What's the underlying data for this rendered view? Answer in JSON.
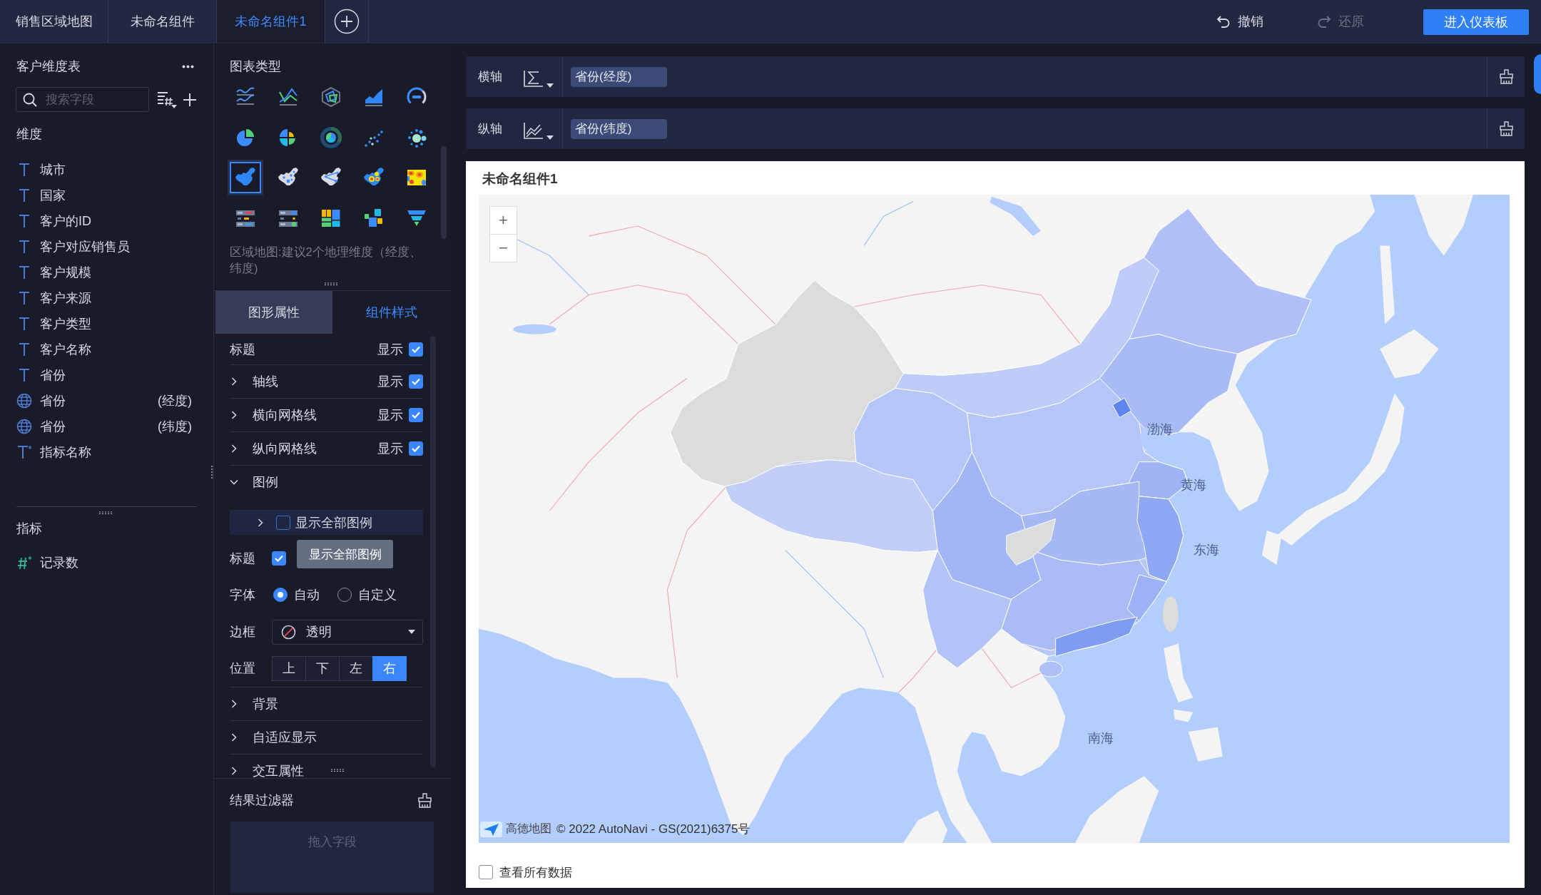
{
  "top_bar": {
    "tabs": [
      {
        "label": "销售区域地图",
        "selected": false
      },
      {
        "label": "未命名组件",
        "selected": false
      },
      {
        "label": "未命名组件1",
        "selected": true
      }
    ],
    "actions": [
      {
        "kind": "undo",
        "label": "撤销",
        "disabled": false
      },
      {
        "kind": "redo",
        "label": "还原",
        "disabled": true
      }
    ],
    "primary_button": "进入仪表板"
  },
  "fields_panel": {
    "title": "客户维度表",
    "search": {
      "placeholder": "搜索字段"
    },
    "dimensions": {
      "title": "维度",
      "items": [
        {
          "kind": "text",
          "label": "城市"
        },
        {
          "kind": "text",
          "label": "国家"
        },
        {
          "kind": "text",
          "label": "客户的ID"
        },
        {
          "kind": "text",
          "label": "客户对应销售员"
        },
        {
          "kind": "text",
          "label": "客户规模"
        },
        {
          "kind": "text",
          "label": "客户来源"
        },
        {
          "kind": "text",
          "label": "客户类型"
        },
        {
          "kind": "text",
          "label": "客户名称"
        },
        {
          "kind": "text",
          "label": "省份"
        },
        {
          "kind": "geo",
          "label": "省份",
          "qualifier": "(经度)"
        },
        {
          "kind": "geo",
          "label": "省份",
          "qualifier": "(纬度)"
        },
        {
          "kind": "text-calculated",
          "label": "指标名称"
        }
      ]
    },
    "measures": {
      "title": "指标",
      "items": [
        {
          "kind": "number-calculated",
          "label": "记录数"
        }
      ]
    }
  },
  "chart_types": {
    "title": "图表类型",
    "items": [
      {
        "kind": "multi-line",
        "selected": false
      },
      {
        "kind": "line",
        "selected": false
      },
      {
        "kind": "radar",
        "selected": false
      },
      {
        "kind": "area",
        "selected": false
      },
      {
        "kind": "gauge",
        "selected": false
      },
      {
        "kind": "pie",
        "selected": false
      },
      {
        "kind": "quadrant-pie",
        "selected": false
      },
      {
        "kind": "nested-donut",
        "selected": false
      },
      {
        "kind": "scatter",
        "selected": false
      },
      {
        "kind": "bubble",
        "selected": false
      },
      {
        "kind": "region-map",
        "selected": true
      },
      {
        "kind": "point-map",
        "selected": false
      },
      {
        "kind": "flow-map",
        "selected": false
      },
      {
        "kind": "heat-map",
        "selected": false
      },
      {
        "kind": "heatmap-grid",
        "selected": false
      },
      {
        "kind": "kpi-table",
        "selected": false
      },
      {
        "kind": "indicator-list",
        "selected": false
      },
      {
        "kind": "treemap",
        "selected": false
      },
      {
        "kind": "word-cloud",
        "selected": false
      },
      {
        "kind": "funnel",
        "selected": false
      }
    ],
    "hint": "区域地图:建议2个地理维度（经度、纬度)"
  },
  "properties_panel": {
    "tabs": [
      {
        "label": "图形属性",
        "selected": true
      },
      {
        "label": "组件样式",
        "selected": false
      }
    ],
    "rows": [
      {
        "kind": "toggle",
        "label": "标题",
        "toggle_label": "显示",
        "checked": true
      },
      {
        "kind": "collapsible-toggle",
        "label": "轴线",
        "expanded": false,
        "toggle_label": "显示",
        "checked": true
      },
      {
        "kind": "collapsible-toggle",
        "label": "横向网格线",
        "expanded": false,
        "toggle_label": "显示",
        "checked": true
      },
      {
        "kind": "collapsible-toggle",
        "label": "纵向网格线",
        "expanded": false,
        "toggle_label": "显示",
        "checked": true
      },
      {
        "kind": "section",
        "label": "图例",
        "expanded": true,
        "children": [
          {
            "kind": "group",
            "label": "显示全部图例",
            "expanded": false,
            "checked": false
          },
          {
            "kind": "checkbox",
            "label": "标题",
            "checked": true
          },
          {
            "kind": "radio",
            "label": "字体",
            "options": [
              {
                "label": "自动",
                "selected": true
              },
              {
                "label": "自定义",
                "selected": false
              }
            ]
          },
          {
            "kind": "select",
            "label": "边框",
            "value": "透明"
          },
          {
            "kind": "segmented",
            "label": "位置",
            "options": [
              {
                "label": "上",
                "selected": false
              },
              {
                "label": "下",
                "selected": false
              },
              {
                "label": "左",
                "selected": false
              },
              {
                "label": "右",
                "selected": true
              }
            ]
          }
        ]
      },
      {
        "kind": "section",
        "label": "背景",
        "expanded": false
      },
      {
        "kind": "section",
        "label": "自适应显示",
        "expanded": false
      },
      {
        "kind": "section",
        "label": "交互属性",
        "expanded": false
      }
    ],
    "tooltip": "显示全部图例"
  },
  "result_filter": {
    "title": "结果过滤器",
    "drop_placeholder": "拖入字段"
  },
  "shelves": [
    {
      "kind": "x-axis",
      "label": "横轴",
      "fields": [
        "省份(经度)"
      ]
    },
    {
      "kind": "y-axis",
      "label": "纵轴",
      "fields": [
        "省份(纬度)"
      ]
    }
  ],
  "chart_card": {
    "title": "未命名组件1",
    "map": {
      "zoom_controls": [
        "+",
        "−"
      ],
      "sea_labels": [
        "渤海",
        "黄海",
        "东海",
        "南海"
      ],
      "attribution_brand": "高德地图",
      "attribution": "© 2022 AutoNavi - GS(2021)6375号"
    },
    "show_all_data": {
      "label": "查看所有数据",
      "checked": false
    }
  }
}
